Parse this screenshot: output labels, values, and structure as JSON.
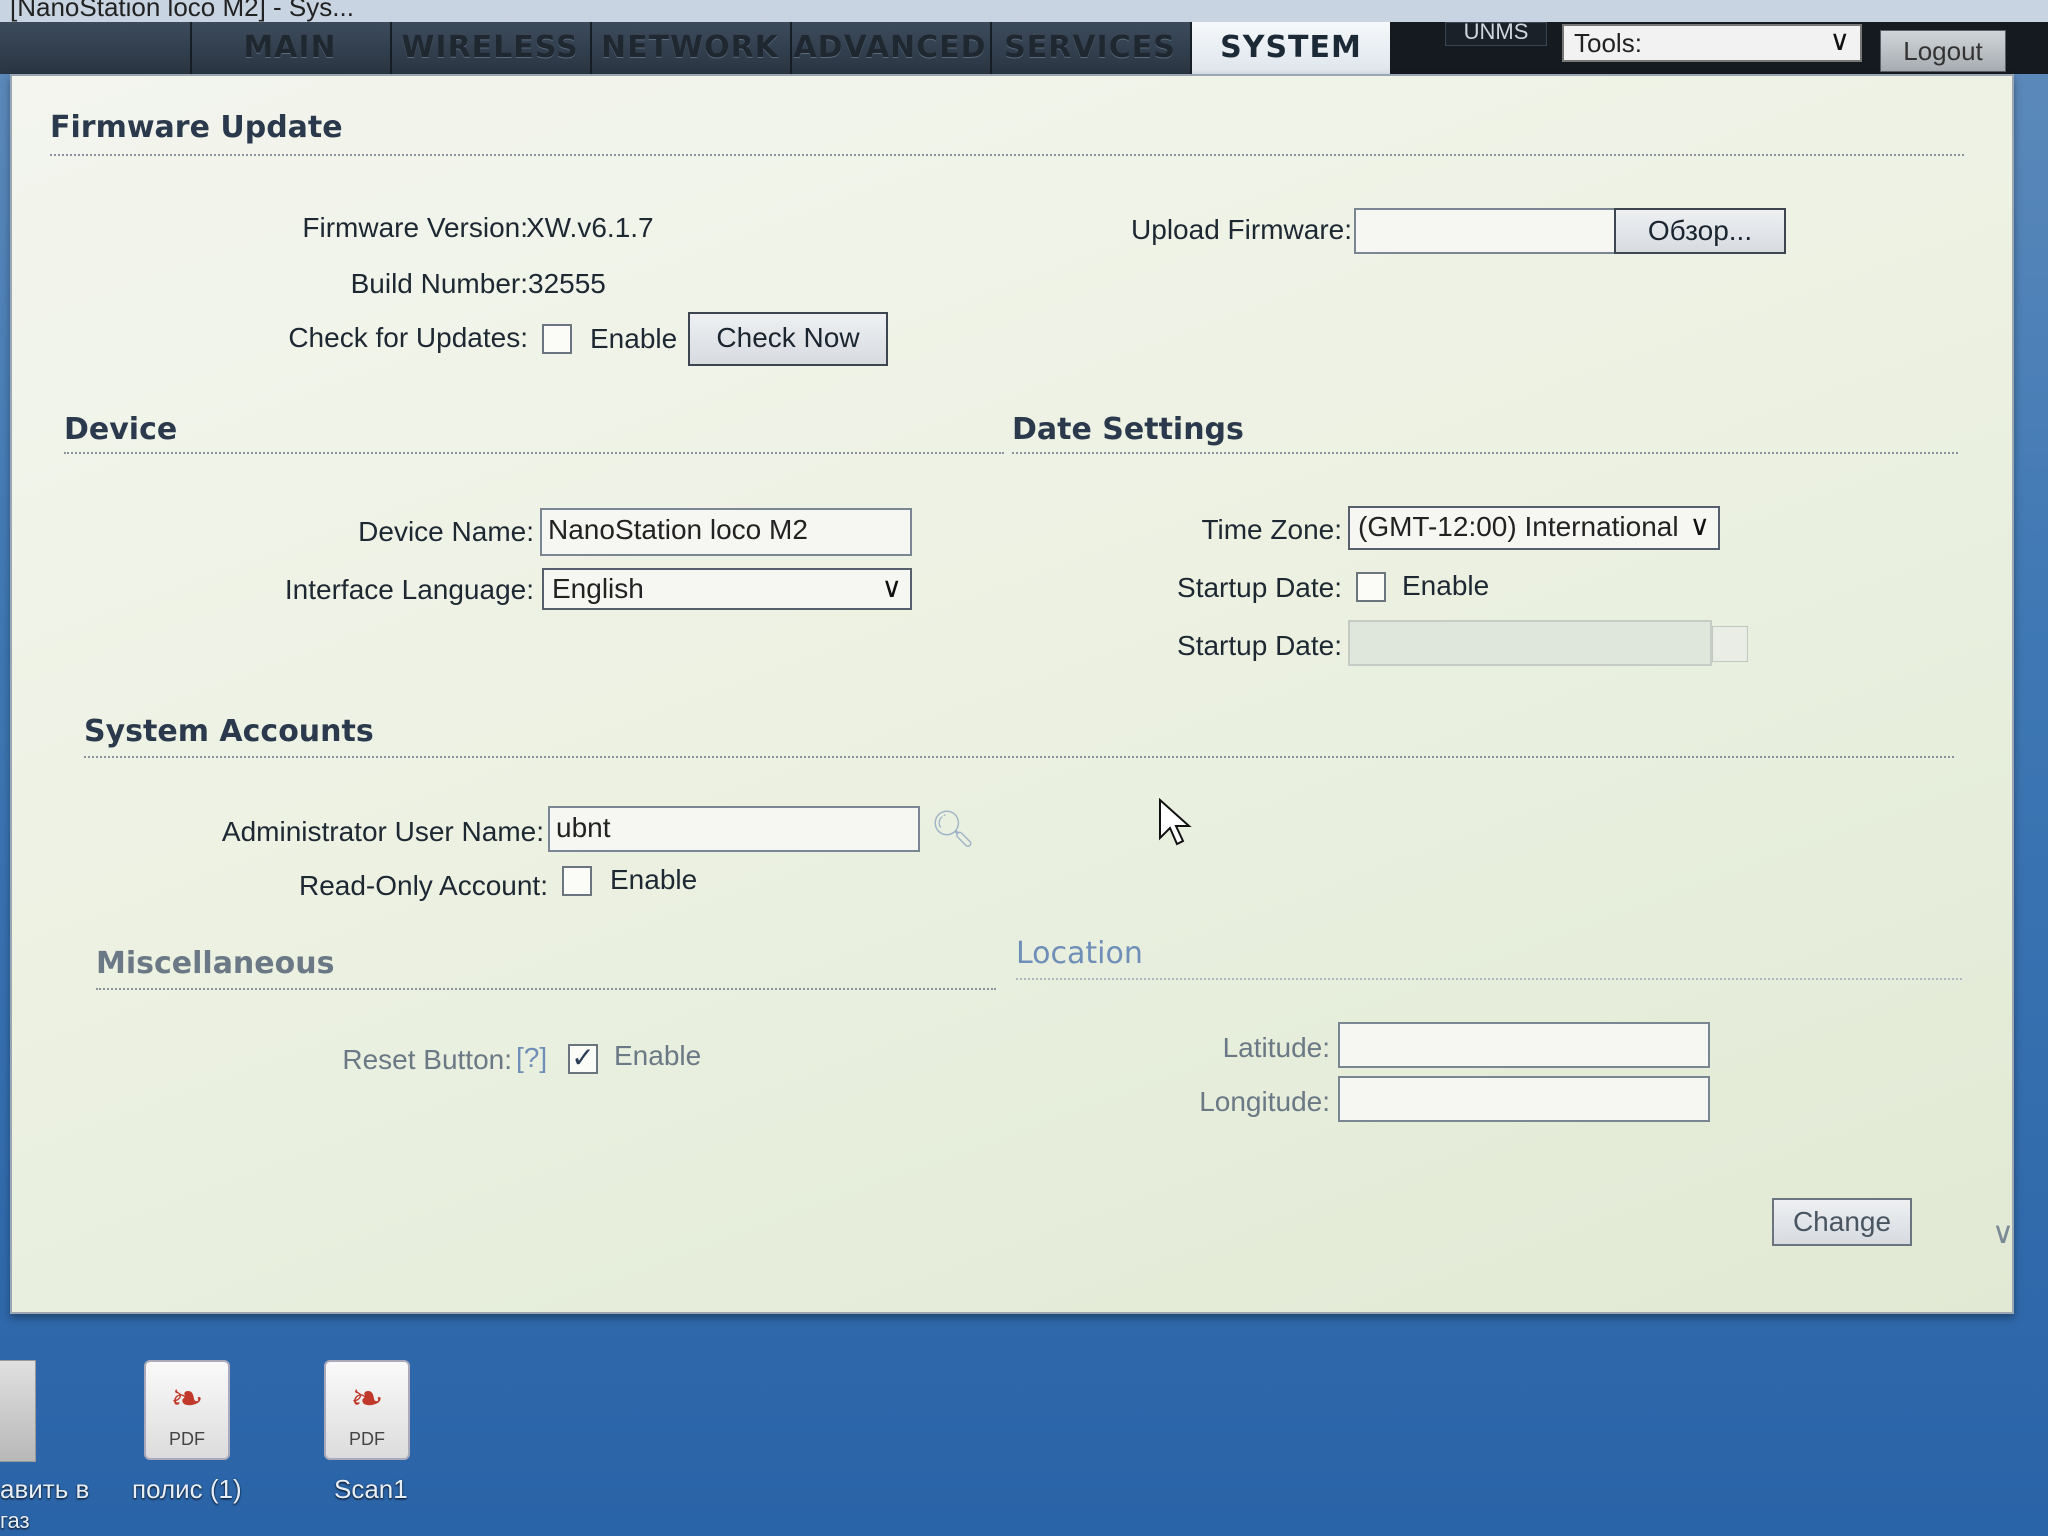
{
  "window": {
    "title": "[NanoStation loco M2] - Sys..."
  },
  "nav": {
    "tabs": [
      "MAIN",
      "WIRELESS",
      "NETWORK",
      "ADVANCED",
      "SERVICES",
      "SYSTEM"
    ],
    "active": "SYSTEM",
    "unms_label": "UNMS",
    "tools_label": "Tools:",
    "logout_label": "Logout"
  },
  "firmware": {
    "title": "Firmware Update",
    "version_label": "Firmware Version:",
    "version_value": "XW.v6.1.7",
    "build_label": "Build Number:",
    "build_value": "32555",
    "check_label": "Check for Updates:",
    "enable_label": "Enable",
    "check_now_label": "Check Now",
    "upload_label": "Upload Firmware:",
    "browse_label": "Обзор..."
  },
  "device": {
    "title": "Device",
    "name_label": "Device Name:",
    "name_value": "NanoStation loco M2",
    "language_label": "Interface Language:",
    "language_value": "English"
  },
  "date": {
    "title": "Date Settings",
    "timezone_label": "Time Zone:",
    "timezone_value": "(GMT-12:00) International",
    "startup_label": "Startup Date:",
    "enable_label": "Enable",
    "startup_date_label": "Startup Date:"
  },
  "accounts": {
    "title": "System Accounts",
    "admin_label": "Administrator User Name:",
    "admin_value": "ubnt",
    "readonly_label": "Read-Only Account:",
    "enable_label": "Enable"
  },
  "misc": {
    "title": "Miscellaneous",
    "reset_label": "Reset Button:",
    "help_label": "[?]",
    "enable_label": "Enable"
  },
  "location": {
    "title": "Location",
    "latitude_label": "Latitude:",
    "longitude_label": "Longitude:"
  },
  "change_label": "Change",
  "desktop": {
    "icons": [
      {
        "badge": "PDF",
        "label": "полис (1)"
      },
      {
        "badge": "PDF",
        "label": "Scan1"
      }
    ],
    "left_label_1": "авить в",
    "left_label_2": "газ"
  }
}
